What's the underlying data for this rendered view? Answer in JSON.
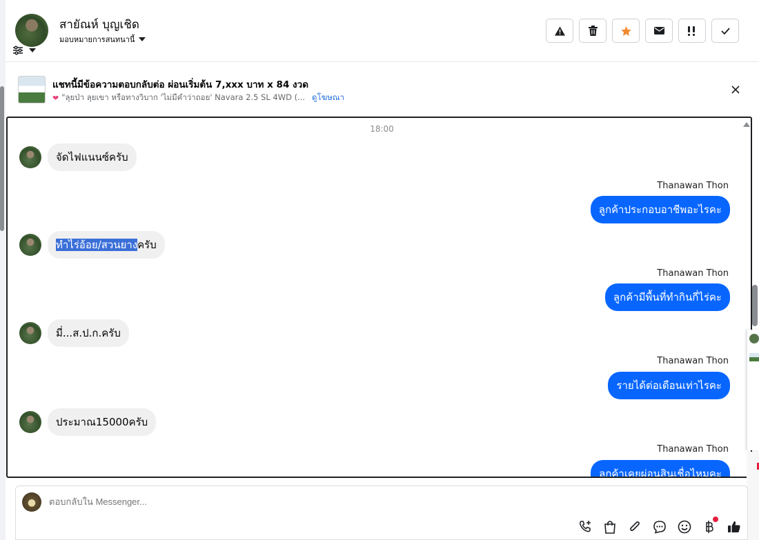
{
  "header": {
    "name": "สายัณห์ บุญเชิด",
    "assign_label": "มอบหมายการสนทนานี้"
  },
  "actions": [
    {
      "name": "report-spam-button",
      "icon": "warning-icon"
    },
    {
      "name": "delete-button",
      "icon": "trash-icon"
    },
    {
      "name": "star-button",
      "icon": "star-icon",
      "color": "#f28a30"
    },
    {
      "name": "mark-unread-button",
      "icon": "envelope-icon"
    },
    {
      "name": "mark-follow-up-button",
      "icon": "follow-up-icon"
    },
    {
      "name": "mark-done-button",
      "icon": "check-icon"
    }
  ],
  "banner": {
    "title": "แชทนี้มีข้อความตอบกลับต่อ ผ่อนเริ่มต้น 7,xxx บาท x 84 งวด",
    "subtitle": "\"ลุยป่า ลุยเขา หรือทางวิบาก 'ไม่มีคำว่าถอย'  Navara 2.5 SL 4WD (...",
    "link": "ดูโฆษณา"
  },
  "chat": {
    "timestamp": "18:00",
    "incoming": [
      {
        "text": "จัดไฟแนนซ์ครับ"
      },
      {
        "highlight": "ทำไร่อ้อย/สวนยาง",
        "text": "ครับ"
      },
      {
        "text": "มี่...ส.ป.ก.ครับ"
      },
      {
        "text": "ประมาณ15000ครับ"
      }
    ],
    "outgoing": [
      {
        "sender": "Thanawan Thon",
        "text": "ลูกค้าประกอบอาชีพอะไรคะ"
      },
      {
        "sender": "Thanawan Thon",
        "text": "ลูกค้ามีพื้นที่ทำกินกี่ไร่คะ"
      },
      {
        "sender": "Thanawan Thon",
        "text": "รายได้ต่อเดือนเท่าไรคะ"
      },
      {
        "sender": "Thanawan Thon",
        "text": "ลูกค้าเคยผ่อนสินเชื่อไหมคะ"
      }
    ]
  },
  "composer": {
    "placeholder": "ตอบกลับใน Messenger..."
  },
  "colors": {
    "accent": "#0866ff",
    "star": "#f28a30",
    "notification": "#e41e3f"
  }
}
